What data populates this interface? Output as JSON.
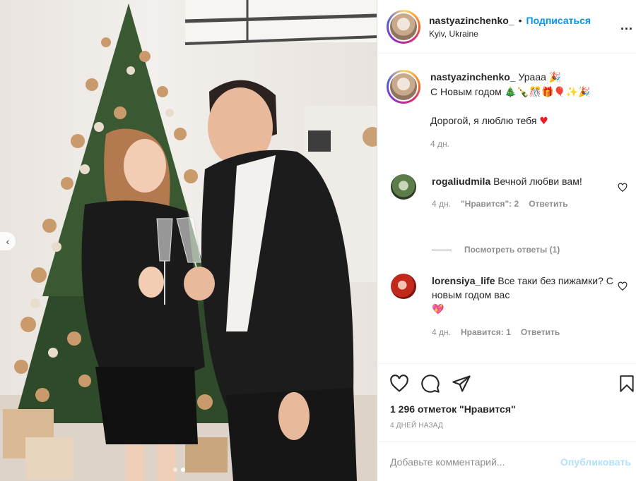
{
  "post": {
    "username": "nastyazinchenko_",
    "separator": "•",
    "follow_label": "Подписаться",
    "location": "Kyiv, Ukraine",
    "more_label": "..."
  },
  "caption": {
    "username": "nastyazinchenko_",
    "line1": "Урааа",
    "line1_emoji": "🎉",
    "line2": "С Новым годом",
    "line2_emoji": "🎄🍾🎊🎁🎈✨🎉",
    "line3": "Дорогой, я люблю тебя",
    "line3_emoji": "♥",
    "time": "4 дн."
  },
  "comments": [
    {
      "username": "rogaliudmila",
      "text": "Вечной любви вам!",
      "time": "4 дн.",
      "likes": "\"Нравится\": 2",
      "reply": "Ответить",
      "view_replies": "Посмотреть ответы (1)"
    },
    {
      "username": "lorensiya_life",
      "text": "Все таки без пижамки? С новым годом вас",
      "emoji": "💖",
      "time": "4 дн.",
      "likes": "Нравится: 1",
      "reply": "Ответить"
    }
  ],
  "actions": {
    "likes_count": "1 296 отметок \"Нравится\"",
    "date": "4 ДНЕЙ НАЗАД"
  },
  "add_comment": {
    "placeholder": "Добавьте комментарий...",
    "publish_label": "Опубликовать"
  },
  "carousel": {
    "prev_label": "‹",
    "active_index": 1,
    "count": 2
  },
  "colors": {
    "link_blue": "#0095f6",
    "publish_disabled": "#b2dffc",
    "meta_gray": "#8e8e8e",
    "text": "#262626"
  }
}
